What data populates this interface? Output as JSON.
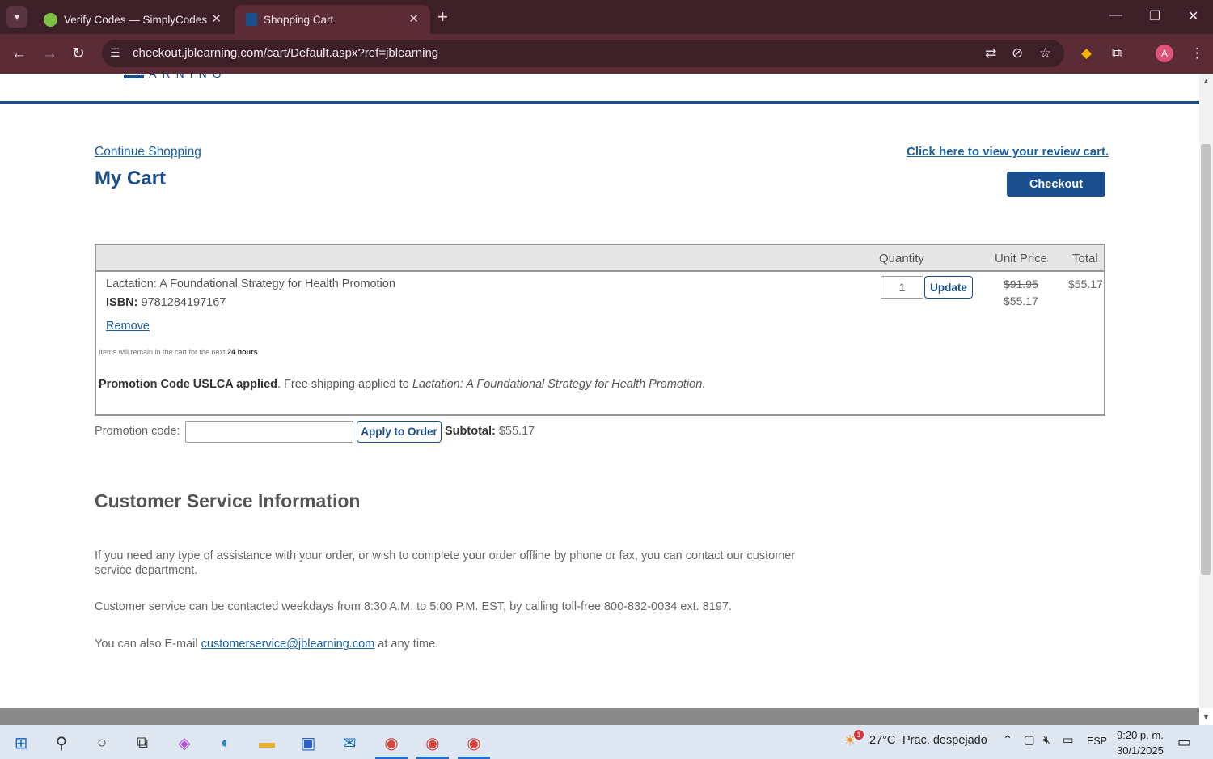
{
  "browser": {
    "tabs": [
      {
        "title": "Verify Codes — SimplyCodes",
        "active": false
      },
      {
        "title": "Shopping Cart",
        "active": true
      }
    ],
    "url": "checkout.jblearning.com/cart/Default.aspx?ref=jblearning",
    "profile_initial": "A",
    "colors": {
      "frame": "#3c1f27",
      "toolbar": "#5b2b36"
    }
  },
  "page": {
    "logo_fragment": "LEARNING",
    "continue_shopping": "Continue Shopping",
    "review_cart_link": "Click here to view your review cart.",
    "title": "My Cart",
    "checkout_label": "Checkout",
    "brand_color": "#1b4e8c",
    "table": {
      "headers": {
        "quantity": "Quantity",
        "unit_price": "Unit Price",
        "total": "Total"
      },
      "items": [
        {
          "name": "Lactation: A Foundational Strategy for Health Promotion",
          "isbn_label": "ISBN:",
          "isbn": "9781284197167",
          "remove_label": "Remove",
          "quantity": "1",
          "update_label": "Update",
          "original_price": "$91.95",
          "unit_price": "$55.17",
          "total": "$55.17"
        }
      ],
      "note_prefix": "Items will remain in the cart for the next",
      "note_hours": "24 hours",
      "promo_applied_bold": "Promotion Code USLCA applied",
      "promo_applied_text": ". Free shipping applied to",
      "promo_applied_product": "Lactation: A Foundational Strategy for Health Promotion",
      "promo_applied_end": "."
    },
    "promo": {
      "label": "Promotion code:",
      "value": "",
      "apply_label": "Apply to Order",
      "subtotal_label": "Subtotal:",
      "subtotal_value": "$55.17"
    },
    "customer_service": {
      "title": "Customer Service Information",
      "p1": "If you need any type of assistance with your order, or wish to complete your order offline by phone or fax, you can contact our customer service department.",
      "p2": "Customer service can be contacted weekdays from 8:30 A.M. to 5:00 P.M. EST, by calling toll-free 800-832-0034 ext. 8197.",
      "p3_prefix": "You can also E-mail",
      "email": "customerservice@jblearning.com",
      "p3_suffix": "at any time."
    }
  },
  "taskbar": {
    "weather_badge": "1",
    "temperature": "27°C",
    "weather": "Prac. despejado",
    "language": "ESP",
    "time": "9:20 p. m.",
    "date": "30/1/2025"
  }
}
